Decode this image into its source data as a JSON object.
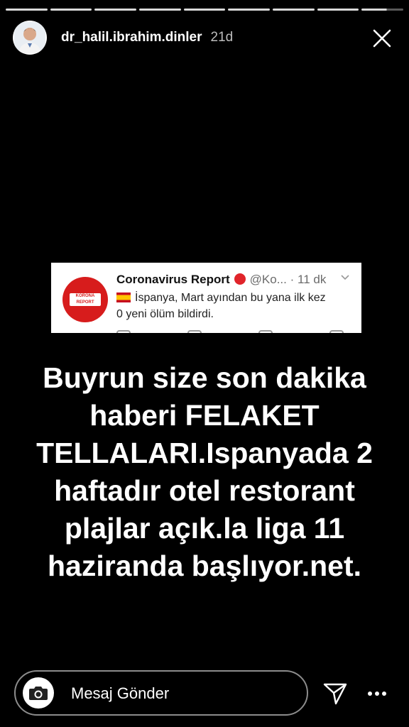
{
  "story": {
    "username": "dr_halil.ibrahim.dinler",
    "time": "21d",
    "progress_segments": 9
  },
  "tweet": {
    "logo_text_1": "KORONA",
    "logo_text_2": "REPORT",
    "name": "Coronavirus Report",
    "handle": "@Ko...",
    "dot": "·",
    "time": "11 dk",
    "text_line_1": "İspanya, Mart ayından bu yana ilk kez",
    "text_line_2": "0 yeni ölüm bildirdi."
  },
  "caption": {
    "lines": [
      "Buyrun size son dakika",
      "haberi FELAKET",
      "TELLALARI.Ispanyada 2",
      "haftadır otel restorant",
      "plajlar açık.la liga 11",
      "haziranda başlıyor.net."
    ]
  },
  "footer": {
    "message_placeholder": "Mesaj Gönder"
  },
  "icons": {
    "close": "close-icon",
    "camera": "camera-icon",
    "send": "send-icon",
    "more": "more-icon"
  }
}
